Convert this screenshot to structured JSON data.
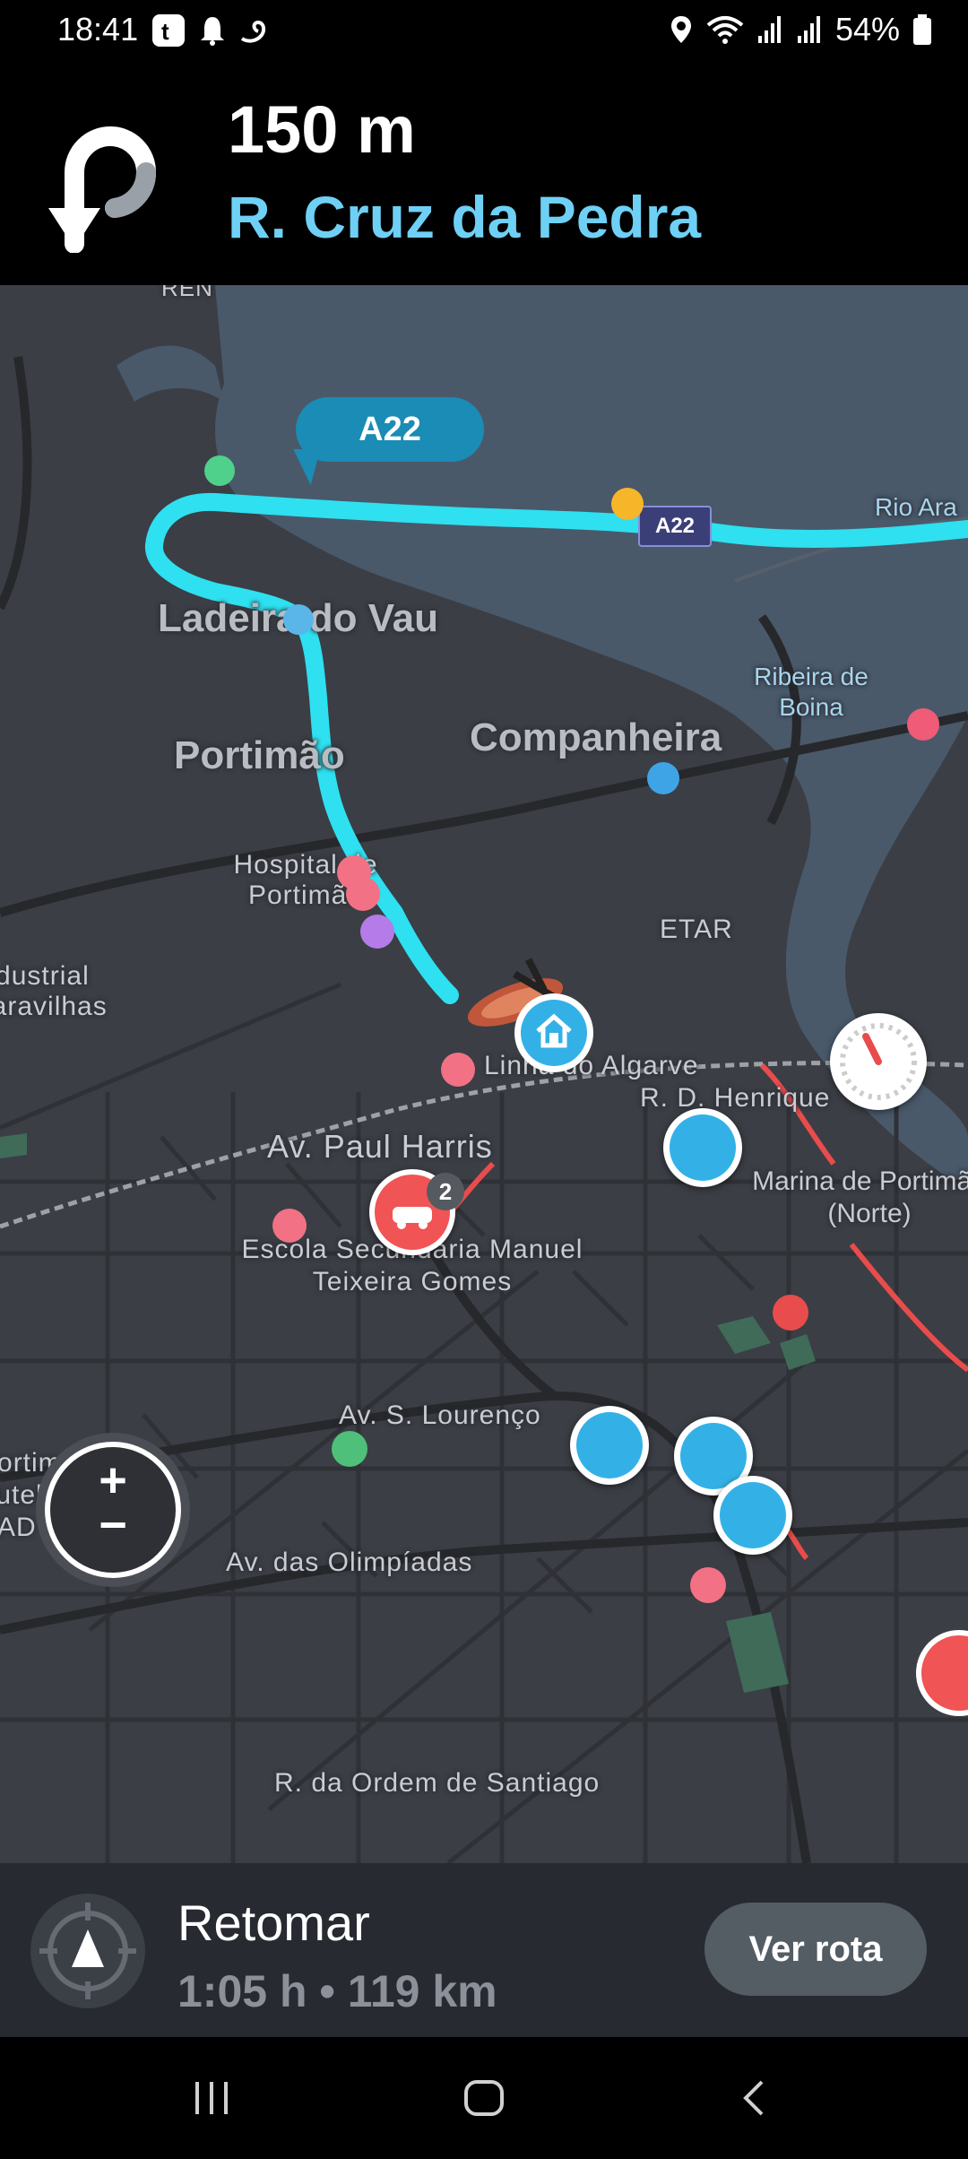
{
  "status_bar": {
    "time": "18:41",
    "battery": "54%"
  },
  "navigation": {
    "distance": "150 m",
    "street": "R. Cruz da Pedra"
  },
  "map": {
    "route_bubble": "A22",
    "shield": "A22",
    "labels": {
      "rio": "Rio Ara",
      "ladeira": "Ladeira do Vau",
      "portimao": "Portimão",
      "companheira": "Companheira",
      "ribeira": "Ribeira de Boina",
      "hospital": "Hospital de Portimão",
      "etar": "ETAR",
      "industrial": "Industrial Caravilhas",
      "linha": "Linha do Algarve",
      "henrique": "R. D. Henrique",
      "paul_harris": "Av. Paul Harris",
      "marina": "Marina de Portimão (Norte)",
      "escola": "Escola Secundária Manuel Teixeira Gomes",
      "lourenco": "Av. S. Lourenço",
      "portimonense": "Portimonense Futebol SAD",
      "olimpiadas": "Av. das Olimpíadas",
      "ordem": "R. da Ordem de Santiago",
      "top_partial": "REN"
    },
    "accident_count": "2",
    "route_color": "#2ee0f0",
    "water_color": "#49596a"
  },
  "bottom_panel": {
    "title": "Retomar",
    "eta": "1:05 h • 119 km",
    "view_route": "Ver rota"
  }
}
